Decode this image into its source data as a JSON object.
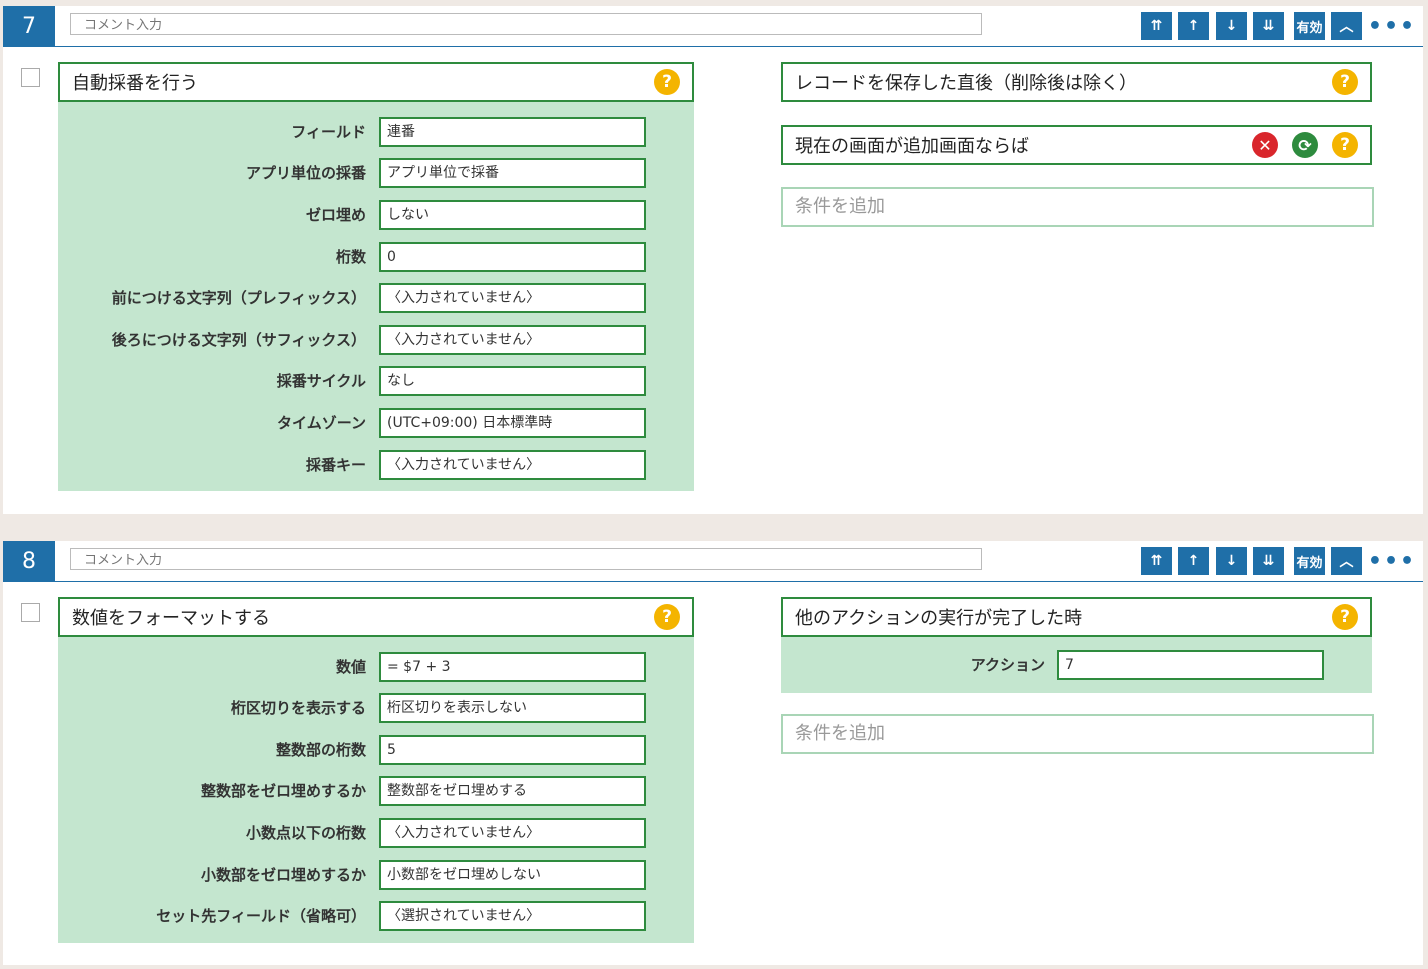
{
  "blocks": [
    {
      "number": "7",
      "comment_placeholder": "コメント入力",
      "toolbar": {
        "move_top": "⇈",
        "move_up": "↑",
        "move_down": "↓",
        "move_bottom": "⇊",
        "enabled_label": "有効",
        "collapse": "︿",
        "more": "•••"
      },
      "action": {
        "title": "自動採番を行う",
        "fields": [
          {
            "label": "フィールド",
            "value": "連番"
          },
          {
            "label": "アプリ単位の採番",
            "value": "アプリ単位で採番"
          },
          {
            "label": "ゼロ埋め",
            "value": "しない"
          },
          {
            "label": "桁数",
            "value": "0"
          },
          {
            "label": "前につける文字列（プレフィックス）",
            "value": "〈入力されていません〉"
          },
          {
            "label": "後ろにつける文字列（サフィックス）",
            "value": "〈入力されていません〉"
          },
          {
            "label": "採番サイクル",
            "value": "なし"
          },
          {
            "label": "タイムゾーン",
            "value": "(UTC+09:00) 日本標準時"
          },
          {
            "label": "採番キー",
            "value": "〈入力されていません〉"
          }
        ]
      },
      "trigger": {
        "title": "レコードを保存した直後（削除後は除く）",
        "conditions": [
          {
            "title": "現在の画面が追加画面ならば"
          }
        ],
        "add_condition": "条件を追加"
      }
    },
    {
      "number": "8",
      "comment_placeholder": "コメント入力",
      "toolbar": {
        "move_top": "⇈",
        "move_up": "↑",
        "move_down": "↓",
        "move_bottom": "⇊",
        "enabled_label": "有効",
        "collapse": "︿",
        "more": "•••"
      },
      "action": {
        "title": "数値をフォーマットする",
        "fields": [
          {
            "label": "数値",
            "value": "= $7 + 3"
          },
          {
            "label": "桁区切りを表示する",
            "value": "桁区切りを表示しない"
          },
          {
            "label": "整数部の桁数",
            "value": "5"
          },
          {
            "label": "整数部をゼロ埋めするか",
            "value": "整数部をゼロ埋めする"
          },
          {
            "label": "小数点以下の桁数",
            "value": "〈入力されていません〉"
          },
          {
            "label": "小数部をゼロ埋めするか",
            "value": "小数部をゼロ埋めしない"
          },
          {
            "label": "セット先フィールド（省略可）",
            "value": "〈選択されていません〉"
          }
        ]
      },
      "trigger": {
        "title": "他のアクションの実行が完了した時",
        "param_label": "アクション",
        "param_value": "7",
        "add_condition": "条件を追加"
      }
    }
  ],
  "icons": {
    "help": "?",
    "delete": "✕",
    "sync": "⟳"
  },
  "colors": {
    "primary_blue": "#1f6fa8",
    "border_green": "#2e8b3e",
    "panel_green": "#c4e6cf",
    "help_yellow": "#f4b400",
    "delete_red": "#d9262c"
  }
}
